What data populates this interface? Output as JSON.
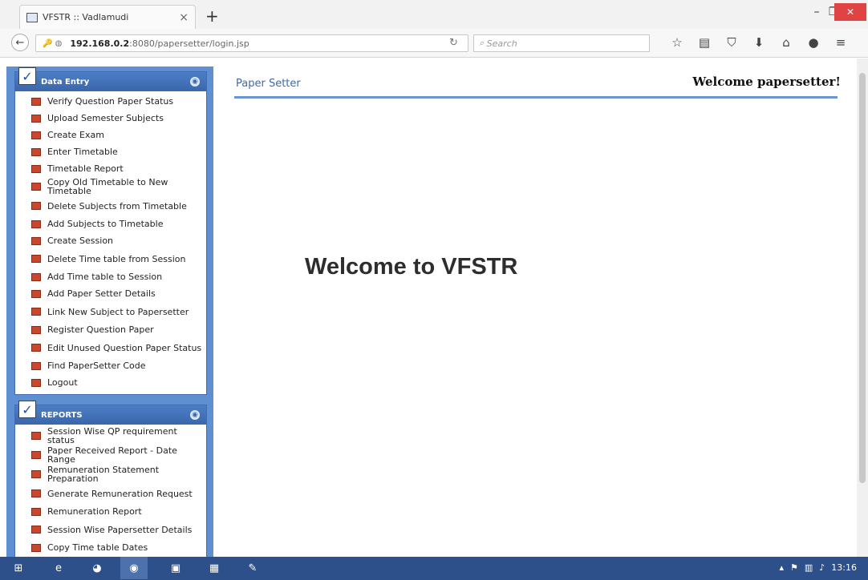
{
  "browser": {
    "tab_title": "VFSTR :: Vadlamudi",
    "tab_close": "×",
    "new_tab": "+",
    "url_host": "192.168.0.2",
    "url_path": ":8080/papersetter/login.jsp",
    "search_placeholder": "Search"
  },
  "sidebar": {
    "data_entry": {
      "title": "Data Entry",
      "items": [
        "Verify Question Paper Status",
        "Upload Semester Subjects",
        "Create Exam",
        "Enter Timetable",
        "Timetable Report",
        "Copy Old Timetable to New Timetable",
        "Delete Subjects from Timetable",
        "Add Subjects to Timetable",
        "Create Session",
        "Delete Time table from Session",
        "Add Time table to Session",
        "Add Paper Setter Details",
        "Link New Subject to Papersetter",
        "Register Question Paper",
        "Edit Unused Question Paper Status",
        "Find PaperSetter Code",
        "Logout"
      ]
    },
    "reports": {
      "title": "REPORTS",
      "items": [
        "Session Wise QP requirement status",
        "Paper Received Report - Date Range",
        "Remuneration Statement Preparation",
        "Generate Remuneration Request",
        "Remuneration Report",
        "Session Wise Papersetter Details",
        "Copy Time table Dates"
      ]
    }
  },
  "header": {
    "app_title": "Paper Setter",
    "welcome_user": "Welcome papersetter!"
  },
  "main": {
    "hero": "Welcome to VFSTR"
  },
  "taskbar": {
    "clock": "13:16"
  }
}
